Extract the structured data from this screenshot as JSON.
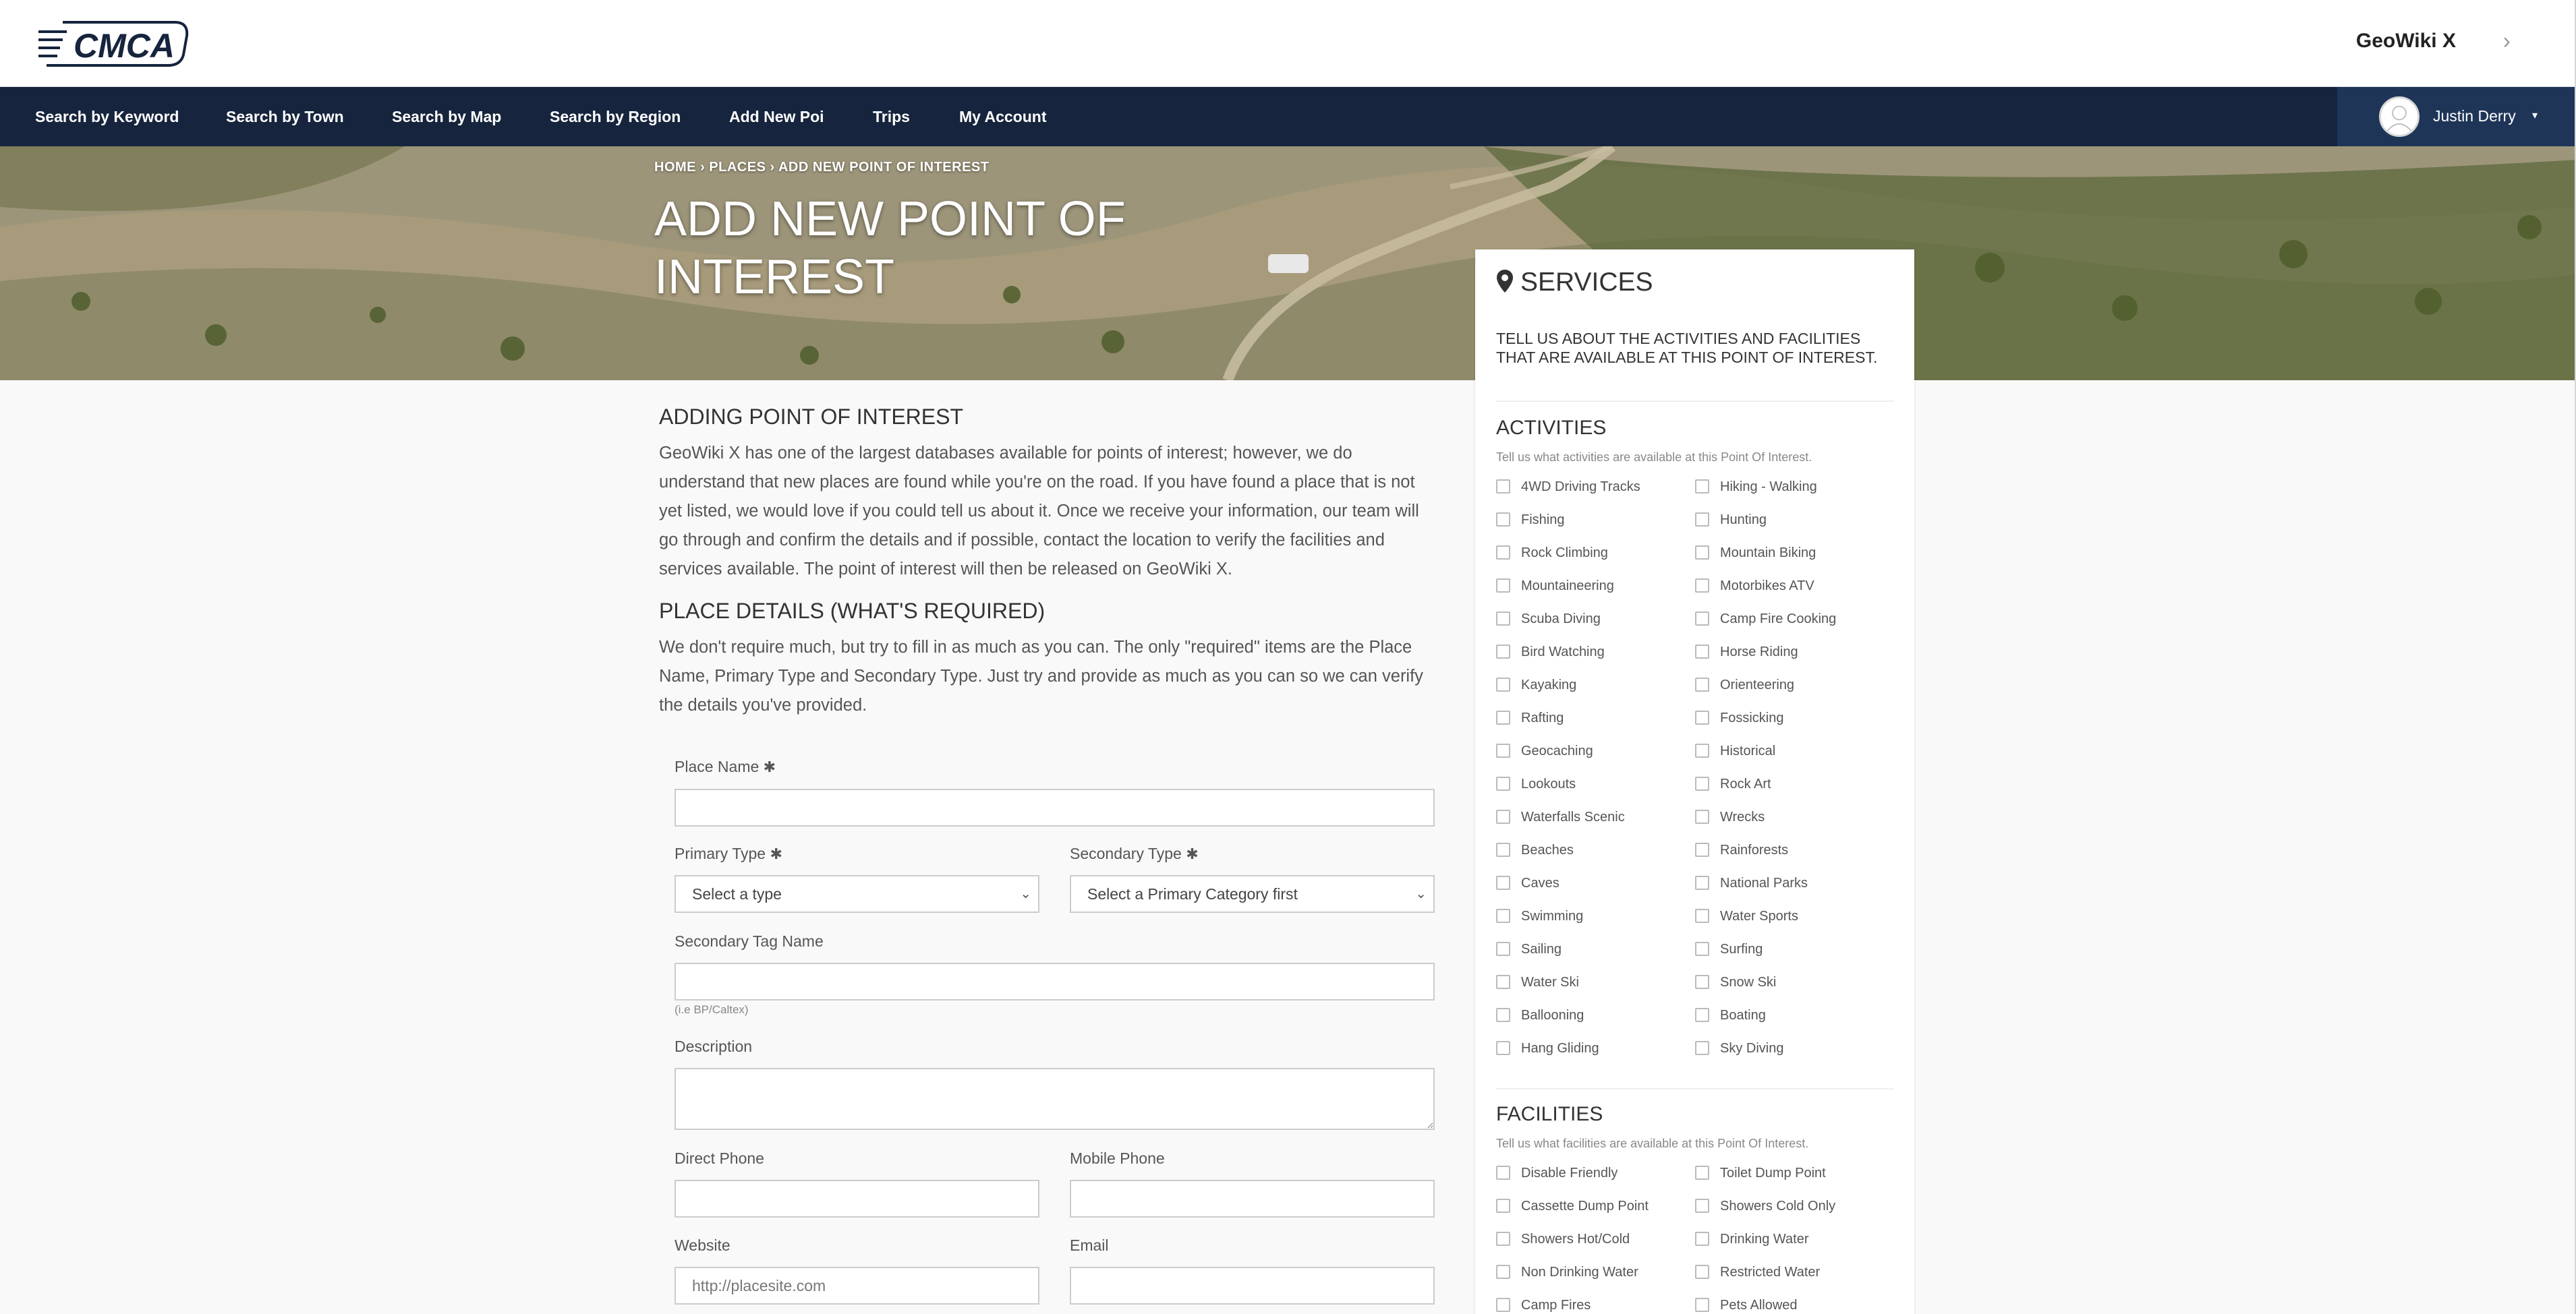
{
  "header": {
    "logo_text": "CMCA",
    "brand": "GeoWiki X",
    "chevron": "›"
  },
  "nav": {
    "items": [
      {
        "label": "Search by Keyword"
      },
      {
        "label": "Search by Town"
      },
      {
        "label": "Search by Map"
      },
      {
        "label": "Search by Region"
      },
      {
        "label": "Add New Poi"
      },
      {
        "label": "Trips"
      },
      {
        "label": "My Account"
      }
    ],
    "user": {
      "name": "Justin Derry",
      "caret": "▾"
    }
  },
  "hero": {
    "breadcrumb": {
      "home": "HOME",
      "places": "PLACES",
      "current": "ADD NEW POINT OF INTEREST",
      "separator": "›"
    },
    "title": "ADD NEW POINT OF INTEREST"
  },
  "main": {
    "adding_heading": "ADDING POINT OF INTEREST",
    "adding_text": "GeoWiki X has one of the largest databases available for points of interest; however, we do understand that new places are found while you're on the road. If you have found a place that is not yet listed, we would love if you could tell us about it. Once we receive your information, our team will go through and confirm the details and if possible, contact the location to verify the facilities and services available. The point of interest will then be released on GeoWiki X.",
    "details_heading": "PLACE DETAILS (WHAT'S REQUIRED)",
    "details_text": "We don't require much, but try to fill in as much as you can. The only \"required\" items are the Place Name, Primary Type and Secondary Type. Just try and provide as much as you can so we can verify the details you've provided."
  },
  "form": {
    "required_mark": "✱",
    "place_name": {
      "label": "Place Name",
      "value": ""
    },
    "primary_type": {
      "label": "Primary Type",
      "selected": "Select a type"
    },
    "secondary_type": {
      "label": "Secondary Type",
      "selected": "Select a Primary Category first"
    },
    "secondary_tag": {
      "label": "Secondary Tag Name",
      "value": "",
      "help": "(i.e BP/Caltex)"
    },
    "description": {
      "label": "Description",
      "value": ""
    },
    "direct_phone": {
      "label": "Direct Phone",
      "value": ""
    },
    "mobile_phone": {
      "label": "Mobile Phone",
      "value": ""
    },
    "website": {
      "label": "Website",
      "placeholder": "http://placesite.com"
    },
    "email": {
      "label": "Email",
      "value": ""
    }
  },
  "services": {
    "title": "SERVICES",
    "intro": "TELL US ABOUT THE ACTIVITIES AND FACILITIES THAT ARE AVAILABLE AT THIS POINT OF INTEREST.",
    "activities": {
      "title": "ACTIVITIES",
      "hint": "Tell us what activities are available at this Point Of Interest.",
      "left": [
        "4WD Driving Tracks",
        "Fishing",
        "Rock Climbing",
        "Mountaineering",
        "Scuba Diving",
        "Bird Watching",
        "Kayaking",
        "Rafting",
        "Geocaching",
        "Lookouts",
        "Waterfalls Scenic",
        "Beaches",
        "Caves",
        "Swimming",
        "Sailing",
        "Water Ski",
        "Ballooning",
        "Hang Gliding"
      ],
      "right": [
        "Hiking - Walking",
        "Hunting",
        "Mountain Biking",
        "Motorbikes ATV",
        "Camp Fire Cooking",
        "Horse Riding",
        "Orienteering",
        "Fossicking",
        "Historical",
        "Rock Art",
        "Wrecks",
        "Rainforests",
        "National Parks",
        "Water Sports",
        "Surfing",
        "Snow Ski",
        "Boating",
        "Sky Diving"
      ]
    },
    "facilities": {
      "title": "FACILITIES",
      "hint": "Tell us what facilities are available at this Point Of Interest.",
      "left": [
        "Disable Friendly",
        "Cassette Dump Point",
        "Showers Hot/Cold",
        "Non Drinking Water",
        "Camp Fires"
      ],
      "right": [
        "Toilet Dump Point",
        "Showers Cold Only",
        "Drinking Water",
        "Restricted Water",
        "Pets Allowed"
      ]
    }
  },
  "colors": {
    "navbar": "#16243d",
    "user_area": "#1e3558",
    "page_bg": "#f9f9f9"
  }
}
